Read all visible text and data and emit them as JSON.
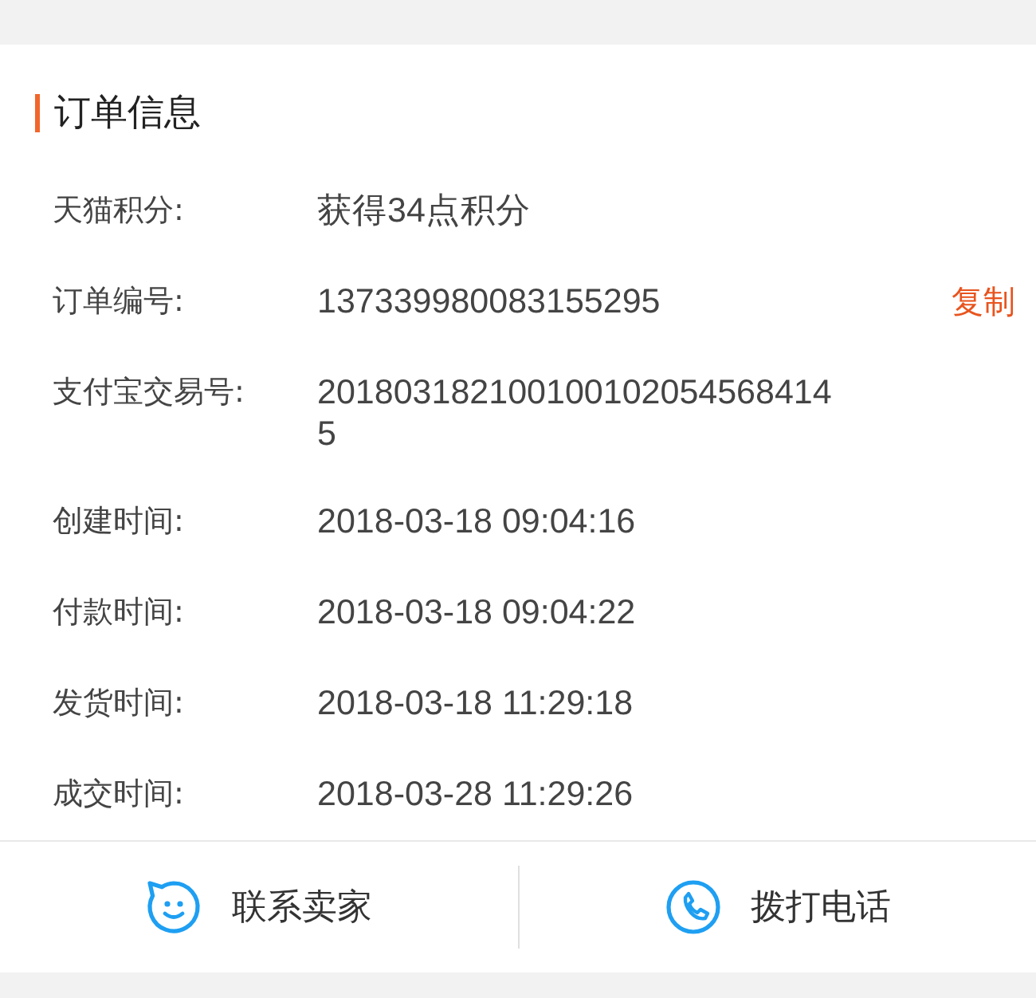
{
  "section": {
    "title": "订单信息"
  },
  "fields": [
    {
      "label": "天猫积分:",
      "value": "获得34点积分"
    },
    {
      "label": "订单编号:",
      "value": "137339980083155295",
      "action": "复制"
    },
    {
      "label": "支付宝交易号:",
      "value": "2018031821001001020545684145"
    },
    {
      "label": "创建时间:",
      "value": "2018-03-18 09:04:16"
    },
    {
      "label": "付款时间:",
      "value": "2018-03-18 09:04:22"
    },
    {
      "label": "发货时间:",
      "value": "2018-03-18 11:29:18"
    },
    {
      "label": "成交时间:",
      "value": "2018-03-28 11:29:26"
    }
  ],
  "buttons": [
    {
      "label": "联系卖家",
      "kind": "chat"
    },
    {
      "label": "拨打电话",
      "kind": "phone"
    }
  ]
}
